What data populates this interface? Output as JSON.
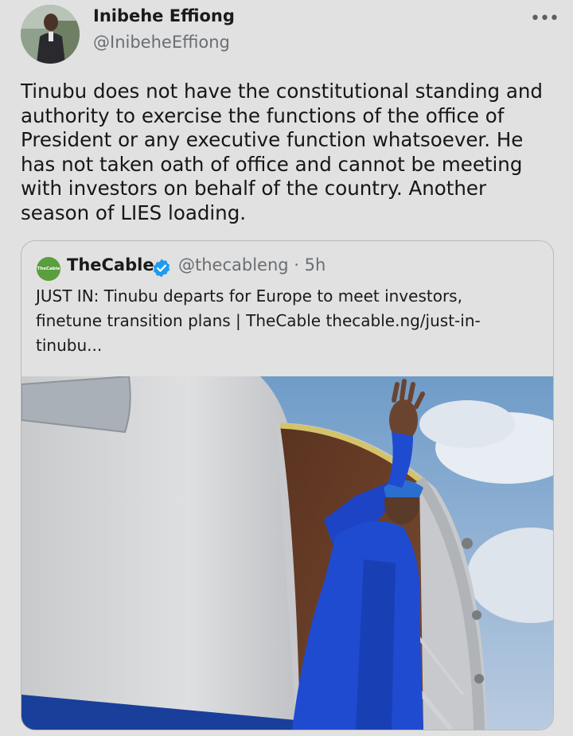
{
  "author": {
    "name": "Inibehe Effiong",
    "handle": "@InibeheEffiong"
  },
  "menu": {
    "more_icon": "more-icon",
    "more_glyph": "•••"
  },
  "tweet": {
    "text": "Tinubu does not have the constitutional standing and authority to exercise the functions of the office of President or any executive function whatsoever. He has not taken oath of office and cannot be meeting with investors on behalf of the country. Another season of LIES loading."
  },
  "quoted": {
    "logo_text": "TheCable",
    "name": "TheCable",
    "handle": "@thecableng",
    "time": "5h",
    "text": "JUST IN: Tinubu departs for Europe to meet investors, finetune transition plans | TheCable thecable.ng/just-in-tinubu...",
    "verified_color": "#1d9bf0",
    "image_subject": "man in blue agbada waving from aircraft door"
  }
}
